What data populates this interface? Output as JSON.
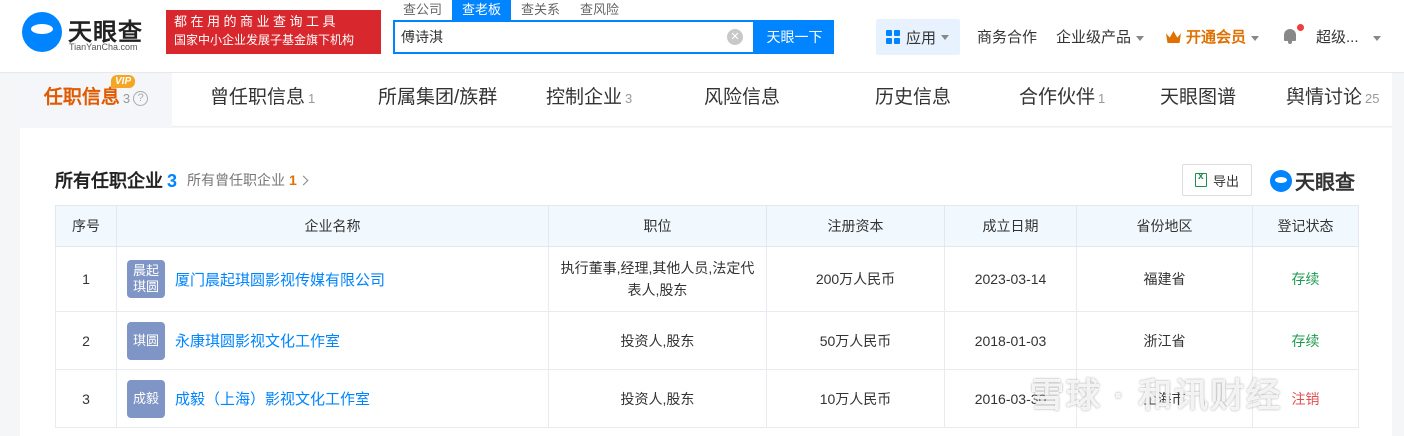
{
  "header": {
    "logo_cn": "天眼查",
    "logo_en": "TianYanCha.com",
    "banner_line1": "都在用的商业查询工具",
    "banner_line2": "国家中小企业发展子基金旗下机构",
    "search_tabs": [
      "查公司",
      "查老板",
      "查关系",
      "查风险"
    ],
    "search_value": "傅诗淇",
    "search_button": "天眼一下",
    "apps_label": "应用",
    "business": "商务合作",
    "enterprise": "企业级产品",
    "vip": "开通会员",
    "user": "超级..."
  },
  "tabs": [
    {
      "label": "任职信息",
      "count": "3"
    },
    {
      "label": "曾任职信息",
      "count": "1"
    },
    {
      "label": "所属集团/族群",
      "count": ""
    },
    {
      "label": "控制企业",
      "count": "3"
    },
    {
      "label": "风险信息",
      "count": ""
    },
    {
      "label": "历史信息",
      "count": ""
    },
    {
      "label": "合作伙伴",
      "count": "1"
    },
    {
      "label": "天眼图谱",
      "count": ""
    },
    {
      "label": "舆情讨论",
      "count": "25"
    }
  ],
  "vip_badge": "VIP",
  "help_symbol": "?",
  "section": {
    "title": "所有任职企业",
    "count": "3",
    "sub_label": "所有曾任职企业",
    "sub_count": "1",
    "export": "导出",
    "brand": "天眼查"
  },
  "table": {
    "headers": [
      "序号",
      "企业名称",
      "职位",
      "注册资本",
      "成立日期",
      "省份地区",
      "登记状态"
    ],
    "rows": [
      {
        "no": "1",
        "logo": "晨起琪圆",
        "name": "厦门晨起琪圆影视传媒有限公司",
        "position": "执行董事,经理,其他人员,法定代表人,股东",
        "capital": "200万人民币",
        "date": "2023-03-14",
        "region": "福建省",
        "status": "存续"
      },
      {
        "no": "2",
        "logo": "琪圆",
        "name": "永康琪圆影视文化工作室",
        "position": "投资人,股东",
        "capital": "50万人民币",
        "date": "2018-01-03",
        "region": "浙江省",
        "status": "存续"
      },
      {
        "no": "3",
        "logo": "成毅",
        "name": "成毅（上海）影视文化工作室",
        "position": "投资人,股东",
        "capital": "10万人民币",
        "date": "2016-03-30",
        "region": "上海市",
        "status": "注销"
      }
    ]
  },
  "watermark": "雪球 · 和讯财经"
}
